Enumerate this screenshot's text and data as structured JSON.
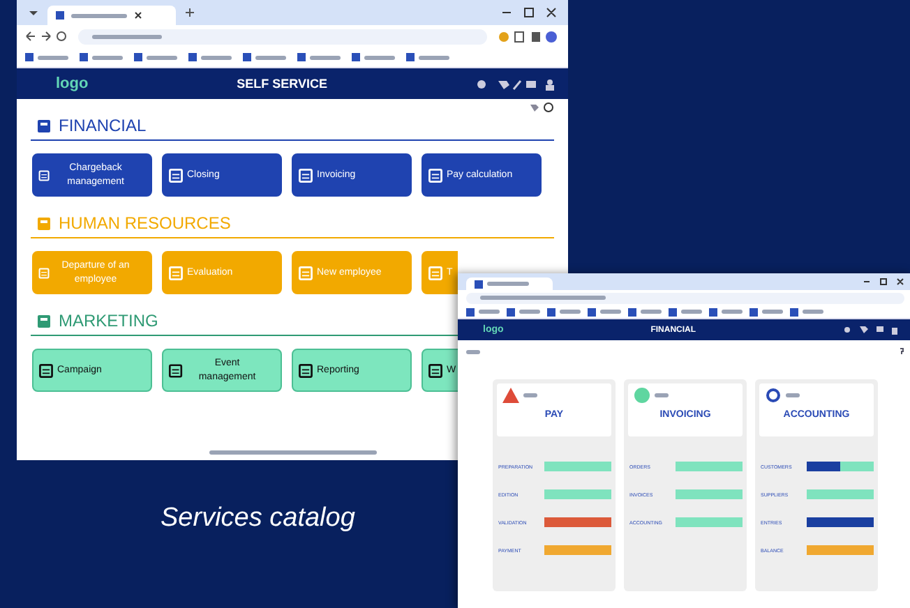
{
  "catalog_window": {
    "header": {
      "logo": "logo",
      "title": "SELF SERVICE"
    },
    "sections": [
      {
        "title": "FINANCIAL",
        "color": "#1f43b0",
        "tiles": [
          {
            "label": "Chargeback management"
          },
          {
            "label": "Closing"
          },
          {
            "label": "Invoicing"
          },
          {
            "label": "Pay calculation"
          }
        ]
      },
      {
        "title": "HUMAN RESOURCES",
        "color": "#f2a900",
        "tiles": [
          {
            "label": "Departure of an employee"
          },
          {
            "label": "Evaluation"
          },
          {
            "label": "New employee"
          },
          {
            "label": "T"
          }
        ]
      },
      {
        "title": "MARKETING",
        "color": "#2f9a74",
        "tiles": [
          {
            "label": "Campaign"
          },
          {
            "label": "Event management"
          },
          {
            "label": "Reporting"
          },
          {
            "label": "W"
          }
        ]
      }
    ]
  },
  "caption": "Services catalog",
  "financial_window": {
    "header": {
      "logo": "logo",
      "title": "FINANCIAL"
    },
    "columns": [
      {
        "title": "PAY",
        "rows": [
          {
            "label": "PREPARATION",
            "segments": [
              {
                "color": "#7fe3be"
              }
            ]
          },
          {
            "label": "EDITION",
            "segments": [
              {
                "color": "#7fe3be"
              }
            ]
          },
          {
            "label": "VALIDATION",
            "segments": [
              {
                "color": "#dc5a3a"
              }
            ]
          },
          {
            "label": "PAYMENT",
            "segments": [
              {
                "color": "#f0a830"
              }
            ]
          }
        ]
      },
      {
        "title": "INVOICING",
        "rows": [
          {
            "label": "ORDERS",
            "segments": [
              {
                "color": "#7fe3be"
              }
            ]
          },
          {
            "label": "INVOICES",
            "segments": [
              {
                "color": "#7fe3be"
              }
            ]
          },
          {
            "label": "ACCOUNTING",
            "segments": [
              {
                "color": "#7fe3be"
              }
            ]
          }
        ]
      },
      {
        "title": "ACCOUNTING",
        "rows": [
          {
            "label": "CUSTOMERS",
            "segments": [
              {
                "color": "#1a3fa0"
              },
              {
                "color": "#7fe3be"
              }
            ]
          },
          {
            "label": "SUPPLIERS",
            "segments": [
              {
                "color": "#7fe3be"
              }
            ]
          },
          {
            "label": "ENTRIES",
            "segments": [
              {
                "color": "#1a3fa0"
              }
            ]
          },
          {
            "label": "BALANCE",
            "segments": [
              {
                "color": "#f0a830"
              }
            ]
          }
        ]
      }
    ]
  }
}
